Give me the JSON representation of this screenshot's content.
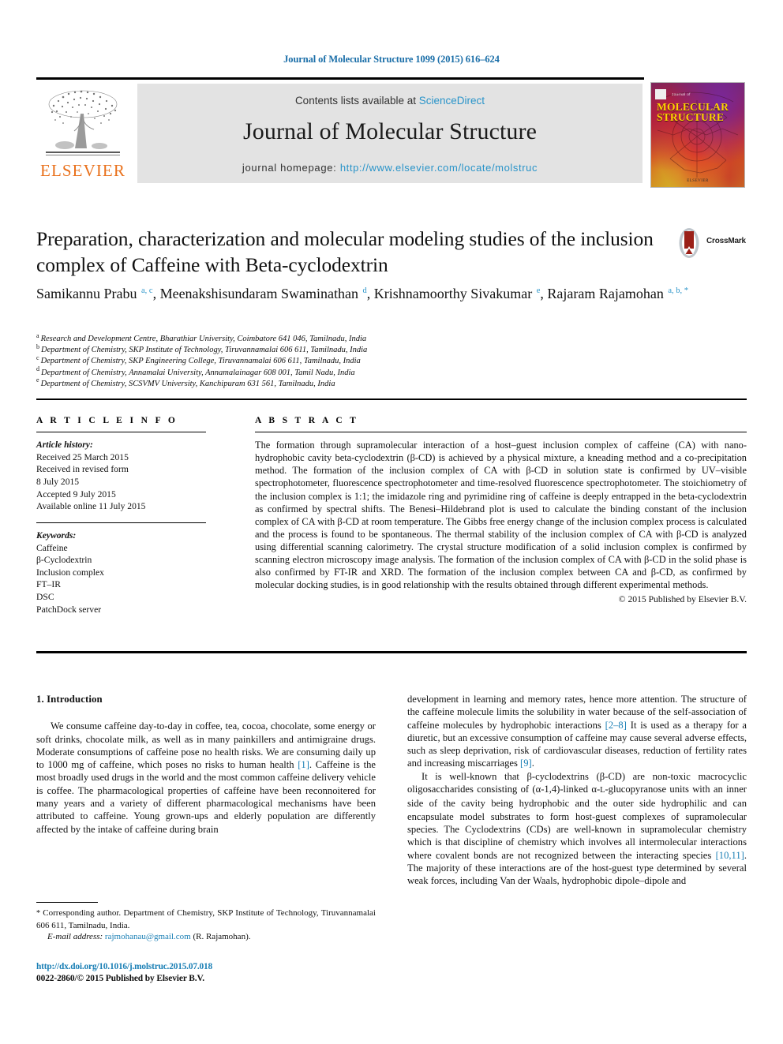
{
  "running_head": "Journal of Molecular Structure 1099 (2015) 616–624",
  "masthead": {
    "contents_prefix": "Contents lists available at ",
    "contents_link": "ScienceDirect",
    "journal_title": "Journal of Molecular Structure",
    "homepage_label": "journal homepage: ",
    "homepage_url": "http://www.elsevier.com/locate/molstruc",
    "publisher_wordmark": "ELSEVIER",
    "cover": {
      "top_small": "Journal of",
      "title_line1": "MOLECULAR",
      "title_line2": "STRUCTURE",
      "bottom_mark": "ELSEVIER"
    }
  },
  "article": {
    "title": "Preparation, characterization and molecular modeling studies of the inclusion complex of Caffeine with Beta-cyclodextrin",
    "crossmark_label": "CrossMark",
    "authors_html": "Samikannu Prabu <sup>a, c</sup>, Meenakshisundaram Swaminathan <sup>d</sup>, Krishnamoorthy Sivakumar <sup>e</sup>, Rajaram Rajamohan <sup>a, b, *</sup>",
    "affiliations": [
      {
        "marker": "a",
        "text": "Research and Development Centre, Bharathiar University, Coimbatore 641 046, Tamilnadu, India"
      },
      {
        "marker": "b",
        "text": "Department of Chemistry, SKP Institute of Technology, Tiruvannamalai 606 611, Tamilnadu, India"
      },
      {
        "marker": "c",
        "text": "Department of Chemistry, SKP Engineering College, Tiruvannamalai 606 611, Tamilnadu, India"
      },
      {
        "marker": "d",
        "text": "Department of Chemistry, Annamalai University, Annamalainagar 608 001, Tamil Nadu, India"
      },
      {
        "marker": "e",
        "text": "Department of Chemistry, SCSVMV University, Kanchipuram 631 561, Tamilnadu, India"
      }
    ]
  },
  "article_info": {
    "kicker": "A R T I C L E  I N F O",
    "history_head": "Article history:",
    "history_lines": [
      "Received 25 March 2015",
      "Received in revised form",
      "8 July 2015",
      "Accepted 9 July 2015",
      "Available online 11 July 2015"
    ],
    "keywords_head": "Keywords:",
    "keywords": [
      "Caffeine",
      "β-Cyclodextrin",
      "Inclusion complex",
      "FT–IR",
      "DSC",
      "PatchDock server"
    ]
  },
  "abstract": {
    "kicker": "A B S T R A C T",
    "text": "The formation through supramolecular interaction of a host–guest inclusion complex of caffeine (CA) with nano-hydrophobic cavity beta-cyclodextrin (β-CD) is achieved by a physical mixture, a kneading method and a co-precipitation method. The formation of the inclusion complex of CA with β-CD in solution state is confirmed by UV–visible spectrophotometer, fluorescence spectrophotometer and time-resolved fluorescence spectrophotometer. The stoichiometry of the inclusion complex is 1:1; the imidazole ring and pyrimidine ring of caffeine is deeply entrapped in the beta-cyclodextrin as confirmed by spectral shifts. The Benesi–Hildebrand plot is used to calculate the binding constant of the inclusion complex of CA with β-CD at room temperature. The Gibbs free energy change of the inclusion complex process is calculated and the process is found to be spontaneous. The thermal stability of the inclusion complex of CA with β-CD is analyzed using differential scanning calorimetry. The crystal structure modification of a solid inclusion complex is confirmed by scanning electron microscopy image analysis. The formation of the inclusion complex of CA with β-CD in the solid phase is also confirmed by FT-IR and XRD. The formation of the inclusion complex between CA and β-CD, as confirmed by molecular docking studies, is in good relationship with the results obtained through different experimental methods.",
    "copyright": "© 2015 Published by Elsevier B.V."
  },
  "introduction": {
    "heading": "1. Introduction",
    "left_html": "We consume caffeine day-to-day in coffee, tea, cocoa, chocolate, some energy or soft drinks, chocolate milk, as well as in many painkillers and antimigraine drugs. Moderate consumptions of caffeine pose no health risks. We are consuming daily up to 1000 mg of caffeine, which poses no risks to human health <span class=\"ref\">[1]</span>. Caffeine is the most broadly used drugs in the world and the most common caffeine delivery vehicle is coffee. The pharmacological properties of caffeine have been reconnoitered for many years and a variety of different pharmacological mechanisms have been attributed to caffeine. Young grown-ups and elderly population are differently affected by the intake of caffeine during brain",
    "right_para1_html": "development in learning and memory rates, hence more attention. The structure of the caffeine molecule limits the solubility in water because of the self-association of caffeine molecules by hydrophobic interactions <span class=\"ref\">[2–8]</span> It is used as a therapy for a diuretic, but an excessive consumption of caffeine may cause several adverse effects, such as sleep deprivation, risk of cardiovascular diseases, reduction of fertility rates and increasing miscarriages <span class=\"ref\">[9]</span>.",
    "right_para2_html": "It is well-known that β-cyclodextrins (β-CD) are non-toxic macrocyclic oligosaccharides consisting of (α-1,4)-linked α-<span style=\"font-size:0.82em\">L</span>-glucopyranose units with an inner side of the cavity being hydrophobic and the outer side hydrophilic and can encapsulate model substrates to form host-guest complexes of supramolecular species. The Cyclodextrins (CDs) are well-known in supramolecular chemistry which is that discipline of chemistry which involves all intermolecular interactions where covalent bonds are not recognized between the interacting species <span class=\"ref\">[10,11]</span>. The majority of these interactions are of the host-guest type determined by several weak forces, including Van der Waals, hydrophobic dipole–dipole and"
  },
  "footer": {
    "corresponding_html": "<span class=\"star\">*</span> Corresponding author. Department of Chemistry, SKP Institute of Technology, Tiruvannamalai 606 611, Tamilnadu, India.",
    "email_label": "E-mail address: ",
    "email_address": "rajmohanau@gmail.com",
    "email_owner": " (R. Rajamohan).",
    "doi_url": "http://dx.doi.org/10.1016/j.molstruc.2015.07.018",
    "issn_line": "0022-2860/© 2015 Published by Elsevier B.V."
  },
  "colors": {
    "link_blue": "#1a7fb5",
    "science_direct_blue": "#2a94c9",
    "elsevier_orange": "#E9711C",
    "cover_yellow": "#FFD400"
  }
}
